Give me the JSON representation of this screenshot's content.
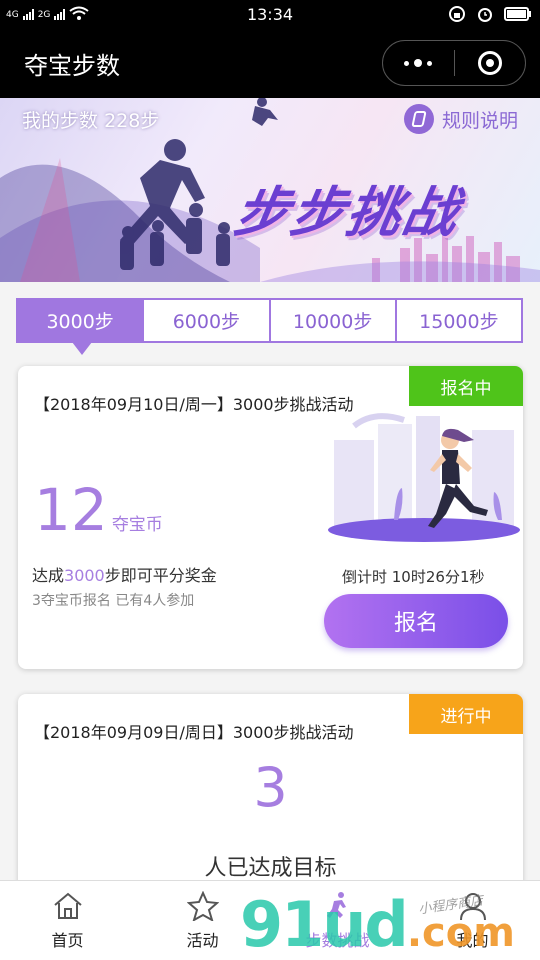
{
  "status_bar": {
    "network_left": "4G",
    "network_right": "2G",
    "time": "13:34"
  },
  "nav": {
    "title": "夺宝步数"
  },
  "banner": {
    "my_steps_label": "我的步数",
    "my_steps_value": "228步",
    "rules_label": "规则说明",
    "headline": "步步挑战"
  },
  "tabs": [
    {
      "label": "3000步",
      "active": true
    },
    {
      "label": "6000步",
      "active": false
    },
    {
      "label": "10000步",
      "active": false
    },
    {
      "label": "15000步",
      "active": false
    }
  ],
  "cards": [
    {
      "title": "【2018年09月10日/周一】3000步挑战活动",
      "badge": "报名中",
      "badge_color": "#4fc41a",
      "coins": "12",
      "coins_unit": "夺宝币",
      "achieve_prefix": "达成",
      "achieve_steps": "3000",
      "achieve_suffix": "步即可平分奖金",
      "fee_text": "3夺宝币报名 已有4人参加",
      "countdown": "倒计时 10时26分1秒",
      "button": "报名"
    },
    {
      "title": "【2018年09月09日/周日】3000步挑战活动",
      "badge": "进行中",
      "badge_color": "#f7a41a",
      "achieved_count": "3",
      "achieved_text": "人已达成目标"
    }
  ],
  "tabbar": [
    {
      "label": "首页",
      "icon": "home-icon",
      "active": false
    },
    {
      "label": "活动",
      "icon": "star-icon",
      "active": false
    },
    {
      "label": "步数挑战",
      "icon": "runner-icon",
      "active": true
    },
    {
      "label": "我的",
      "icon": "user-icon",
      "active": false
    }
  ],
  "watermark": {
    "main": "91ud",
    "suffix": ".com",
    "small": "小程序商店"
  },
  "colors": {
    "accent": "#a077e0",
    "nav_bg": "#000000"
  }
}
